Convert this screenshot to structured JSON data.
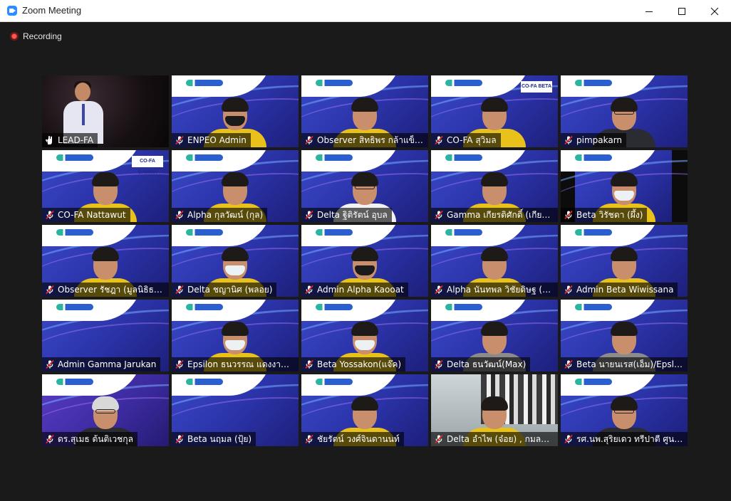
{
  "window": {
    "title": "Zoom Meeting",
    "controls": [
      "minimize-icon",
      "maximize-icon",
      "close-icon"
    ]
  },
  "recording": {
    "label": "Recording",
    "icon": "recording-dot-icon",
    "color": "#e0312f"
  },
  "colors": {
    "active_speaker_border": "#d6e67a",
    "background": "#1a1a1a",
    "tile_blue": "#2a32a6"
  },
  "participants": [
    {
      "name": "LEAD-FA",
      "status_icon": "raised-hand-icon",
      "style": "stage",
      "active": true
    },
    {
      "name": "ENPEO Admin",
      "status_icon": "muted-mic-icon",
      "style": "mask-black"
    },
    {
      "name": "Observer สิทธิพร กล้าแข็ง...",
      "status_icon": "muted-mic-icon",
      "style": "man"
    },
    {
      "name": "CO-FA สุวิมล",
      "status_icon": "muted-mic-icon",
      "style": "woman",
      "badge": "CO-FA BETA"
    },
    {
      "name": "pimpakarn",
      "status_icon": "muted-mic-icon",
      "style": "glasses-dark"
    },
    {
      "name": "CO-FA Nattawut",
      "status_icon": "muted-mic-icon",
      "style": "man",
      "badge": "CO-FA GAMMA"
    },
    {
      "name": "Alpha กุลวัฒน์ (กุล)",
      "status_icon": "muted-mic-icon",
      "style": "man"
    },
    {
      "name": "Delta ฐิติรัตน์ อุบล",
      "status_icon": "muted-mic-icon",
      "style": "glasses"
    },
    {
      "name": "Gamma เกียรติศักดิ์ (เกียรติ)",
      "status_icon": "muted-mic-icon",
      "style": "man"
    },
    {
      "name": "Beta วิรัชดา (ผึ้ง)",
      "status_icon": "muted-mic-icon",
      "style": "mask-side"
    },
    {
      "name": "Observer รัชฎา (มูลนิธิธรร...",
      "status_icon": "muted-mic-icon",
      "style": "woman-dark"
    },
    {
      "name": "Delta ชญานิศ (พลอย)",
      "status_icon": "muted-mic-icon",
      "style": "mask"
    },
    {
      "name": "Admin Alpha Kaooat",
      "status_icon": "muted-mic-icon",
      "style": "mask-black"
    },
    {
      "name": "Alpha นันทพล วิชัยดิษฐ (โอ)",
      "status_icon": "muted-mic-icon",
      "style": "man"
    },
    {
      "name": "Admin Beta Wiwissana",
      "status_icon": "muted-mic-icon",
      "style": "woman"
    },
    {
      "name": "Admin Gamma Jarukan",
      "status_icon": "muted-mic-icon",
      "style": "empty"
    },
    {
      "name": "Epsilon ธนวรรณ แดงงาม(...",
      "status_icon": "muted-mic-icon",
      "style": "mask"
    },
    {
      "name": "Beta Yossakon(แจ๊ค)",
      "status_icon": "muted-mic-icon",
      "style": "mask"
    },
    {
      "name": "Delta ธนวัฒน์(Max)",
      "status_icon": "muted-mic-icon",
      "style": "dark-close"
    },
    {
      "name": "Beta นายนเรส(เอ็ม)/Epslio...",
      "status_icon": "muted-mic-icon",
      "style": "man-small"
    },
    {
      "name": "ดร.สุเมธ ต้นติเวชกุล",
      "status_icon": "muted-mic-icon",
      "style": "elder",
      "variant": "violet"
    },
    {
      "name": "Beta นฤมล (ปุ้ย)",
      "status_icon": "muted-mic-icon",
      "style": "empty"
    },
    {
      "name": "ชัยรัตน์ วงศ์จินดานนท์",
      "status_icon": "muted-mic-icon",
      "style": "man"
    },
    {
      "name": "Delta อำไพ (จ๋อย) , กมลสั้...",
      "status_icon": "muted-mic-icon",
      "style": "office"
    },
    {
      "name": "รศ.นพ.สุริยเดว ทรีปาตี ศูนย์คุณธรรม",
      "status_icon": "muted-mic-icon",
      "style": "glasses-dark"
    }
  ]
}
